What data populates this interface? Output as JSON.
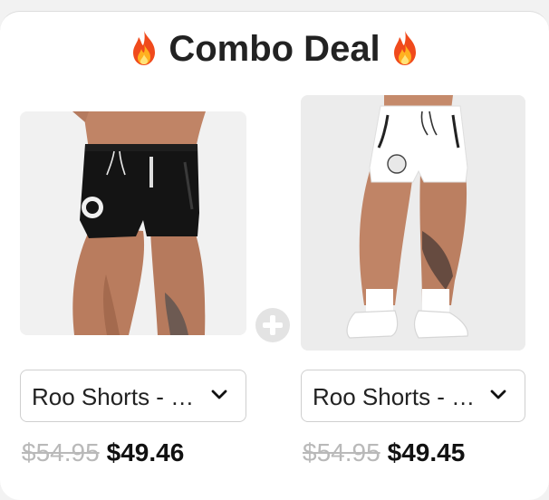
{
  "header": {
    "title": "Combo Deal",
    "left_icon": "fire-icon",
    "right_icon": "fire-icon"
  },
  "products": [
    {
      "image": "black-shorts-photo",
      "variant_label": "Roo Shorts - …",
      "old_price": "$54.95",
      "new_price": "$49.46"
    },
    {
      "image": "white-shorts-photo",
      "variant_label": "Roo Shorts - …",
      "old_price": "$54.95",
      "new_price": "$49.45"
    }
  ],
  "combo_icon": "plus-icon",
  "colors": {
    "title": "#222222",
    "old_price": "#b9b9b9",
    "new_price": "#111111",
    "plus_circle": "#e3e3e3"
  }
}
